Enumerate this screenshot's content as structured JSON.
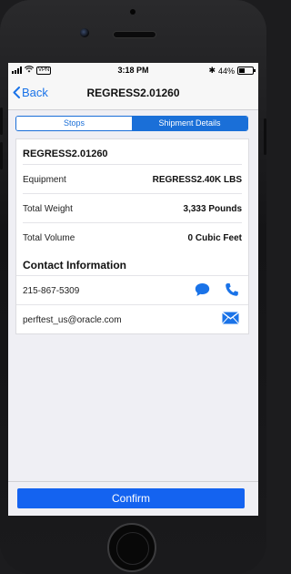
{
  "status_bar": {
    "carrier_badge": "VPN",
    "time": "3:18 PM",
    "battery_percent": "44%",
    "battery_level": 0.44,
    "bluetooth": "✱"
  },
  "nav": {
    "back_label": "Back",
    "title": "REGRESS2.01260"
  },
  "tabs": [
    {
      "label": "Stops",
      "selected": false
    },
    {
      "label": "Shipment Details",
      "selected": true
    }
  ],
  "shipment": {
    "id": "REGRESS2.01260",
    "rows": [
      {
        "label": "Equipment",
        "value": "REGRESS2.40K LBS"
      },
      {
        "label": "Total Weight",
        "value": "3,333 Pounds"
      },
      {
        "label": "Total Volume",
        "value": "0 Cubic Feet"
      }
    ]
  },
  "contact": {
    "title": "Contact Information",
    "phone": "215-867-5309",
    "email": "perftest_us@oracle.com"
  },
  "confirm_label": "Confirm",
  "colors": {
    "accent": "#1a6fd8",
    "confirm": "#1463f0"
  }
}
